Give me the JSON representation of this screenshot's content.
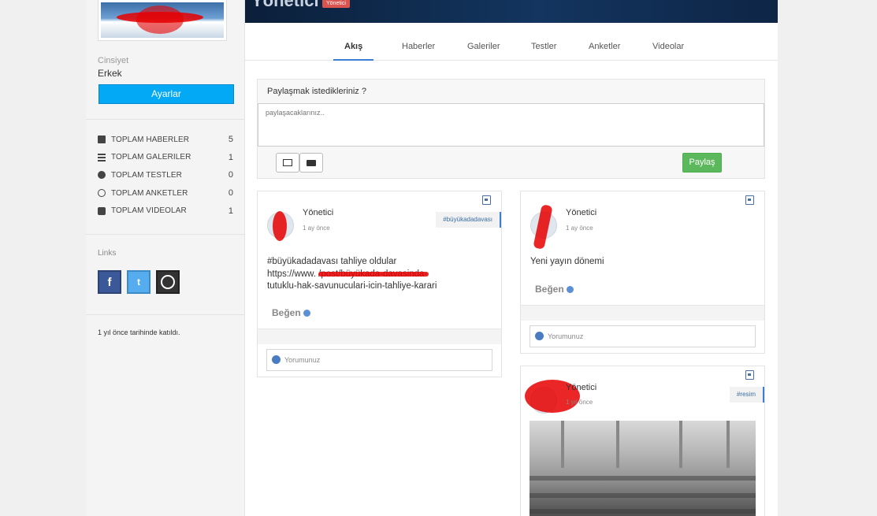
{
  "profile": {
    "name": "Yönetici",
    "role_badge": "Yönetici",
    "gender_label": "Cinsiyet",
    "gender_value": "Erkek",
    "settings_button": "Ayarlar",
    "stats": [
      {
        "icon": "file-icon",
        "label": "TOPLAM HABERLER",
        "count": "5"
      },
      {
        "icon": "list-icon",
        "label": "TOPLAM GALERILER",
        "count": "1"
      },
      {
        "icon": "question-icon",
        "label": "TOPLAM TESTLER",
        "count": "0"
      },
      {
        "icon": "check-circle-icon",
        "label": "TOPLAM ANKETLER",
        "count": "0"
      },
      {
        "icon": "play-icon",
        "label": "TOPLAM VIDEOLAR",
        "count": "1"
      }
    ],
    "links_label": "Links",
    "joined": "1 yıl önce tarihinde katıldı."
  },
  "tabs": [
    "Akış",
    "Haberler",
    "Galeriler",
    "Testler",
    "Anketler",
    "Videolar"
  ],
  "composer": {
    "title": "Paylaşmak istedikleriniz ?",
    "placeholder": "paylaşacaklarınız..",
    "share_button": "Paylaş"
  },
  "posts": [
    {
      "user": "Yönetici",
      "time": "1 ay önce",
      "tag": "#büyükadadavası",
      "text_line1": "#büyükadadavası tahliye oldular",
      "text_line2": "https://www.                /post/büyükada-davasinda-",
      "text_line3": "tutuklu-hak-savunuculari-icin-tahliye-karari",
      "like": "Beğen",
      "comment_placeholder": "Yorumunuz"
    },
    {
      "user": "Yönetici",
      "time": "1 ay önce",
      "text": "Yeni yayın dönemi",
      "like": "Beğen",
      "comment_placeholder": "Yorumunuz"
    },
    {
      "user": "Yönetici",
      "time": "1 yıl önce",
      "tag": "#resim"
    }
  ],
  "colors": {
    "accent": "#03a9f4",
    "share": "#5cb85c",
    "tab_active": "#3a7fd5",
    "facebook": "#3b5998",
    "twitter": "#55acee"
  }
}
